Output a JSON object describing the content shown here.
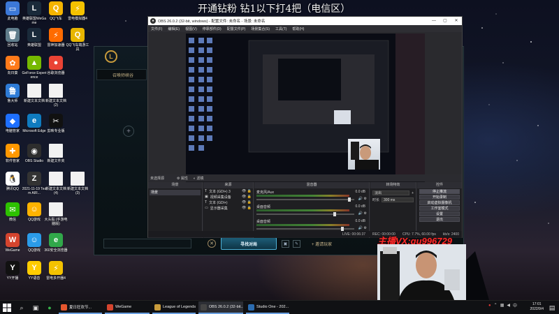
{
  "stream_title": "开通钻粉 钻1以下打4把（电信区）",
  "desktop_icons": [
    {
      "label": "此电脑",
      "glyph": "▭",
      "color": "#3c78d8"
    },
    {
      "label": "英雄联盟WeGame",
      "glyph": "L",
      "color": "#1a2a3a"
    },
    {
      "label": "QQ飞车",
      "glyph": "Q",
      "color": "#f5b400"
    },
    {
      "label": "雷电模拟器4",
      "glyph": "⚡",
      "color": "#f4c200"
    },
    {
      "label": "回收站",
      "glyph": "🗑",
      "color": "#607d8b"
    },
    {
      "label": "英雄联盟",
      "glyph": "L",
      "color": "#1a2a3a"
    },
    {
      "label": "雷神加速器",
      "glyph": "⚡",
      "color": "#ff6b00"
    },
    {
      "label": "QQ飞车端游工具",
      "glyph": "Q",
      "color": "#e8b600"
    },
    {
      "label": "向日葵",
      "glyph": "✿",
      "color": "#ff7a1a"
    },
    {
      "label": "GeForce Experience",
      "glyph": "▲",
      "color": "#76b900"
    },
    {
      "label": "谷歌浏览器",
      "glyph": "●",
      "color": "#ea4335"
    },
    {
      "label": "鲁大师",
      "glyph": "鲁",
      "color": "#2e7bd6"
    },
    {
      "label": "新建文本文档",
      "glyph": "",
      "color": "#f2f2f2"
    },
    {
      "label": "新建文本文档 (2)",
      "glyph": "",
      "color": "#f2f2f2"
    },
    {
      "label": "电脑管家",
      "glyph": "◆",
      "color": "#1e6fff"
    },
    {
      "label": "Microsoft Edge",
      "glyph": "e",
      "color": "#0f7bbf"
    },
    {
      "label": "剪映专业版",
      "glyph": "✂",
      "color": "#111111"
    },
    {
      "label": "软件管家",
      "glyph": "✚",
      "color": "#ff9800"
    },
    {
      "label": "OBS Studio",
      "glyph": "◉",
      "color": "#2d2d2d"
    },
    {
      "label": "新建文件夹",
      "glyph": "",
      "color": "#f2f2f2"
    },
    {
      "label": "腾讯QQ",
      "glyph": "🐧",
      "color": "#ffffff"
    },
    {
      "label": "2021-11-19 Team AIR...",
      "glyph": "Z",
      "color": "#333333"
    },
    {
      "label": "新建文本文档 (4)",
      "glyph": "",
      "color": "#f2f2f2"
    },
    {
      "label": "新建文本文档 (3)",
      "glyph": "",
      "color": "#f2f2f2"
    },
    {
      "label": "微信",
      "glyph": "✉",
      "color": "#2dc100"
    },
    {
      "label": "QQ游戏",
      "glyph": "☺",
      "color": "#ffb300"
    },
    {
      "label": "大头贴 (手游电脑版)",
      "glyph": "",
      "color": "#f2f2f2"
    },
    {
      "label": "WeGame",
      "glyph": "W",
      "color": "#d4442e"
    },
    {
      "label": "QQ游戏",
      "glyph": "☺",
      "color": "#2b9be8"
    },
    {
      "label": "360安全浏览器",
      "glyph": "e",
      "color": "#31a84a"
    },
    {
      "label": "YY开播",
      "glyph": "Y",
      "color": "#111111"
    },
    {
      "label": "YY语音",
      "glyph": "Y",
      "color": "#ffcc00"
    },
    {
      "label": "雷电多开器4",
      "glyph": "⚡",
      "color": "#f4c200"
    }
  ],
  "lol": {
    "logo": "L",
    "tab_label": "召唤师峡谷",
    "find_match": "寻找对局",
    "invite": "邀请玩家",
    "close": "✕"
  },
  "obs": {
    "title": "OBS 26.0.2 (32-bit, windows) - 配置文件: 未命名 - 场景: 未命名",
    "menu": [
      "文件(F)",
      "编辑(E)",
      "视图(V)",
      "停靠部件(D)",
      "配置文件(P)",
      "场景集合(S)",
      "工具(T)",
      "帮助(H)"
    ],
    "no_source": "未选择源",
    "properties": "属性",
    "filters": "滤镜",
    "docks": {
      "scenes": "场景",
      "sources": "来源",
      "mixer": "混音器",
      "transitions": "转场特效",
      "controls": "控件"
    },
    "scene_item": "场景",
    "sources_list": [
      {
        "label": "文本 (GDI+) 3",
        "icon": "T"
      },
      {
        "label": "视频采集设备",
        "icon": "▣"
      },
      {
        "label": "文本 (GDI+)",
        "icon": "T"
      },
      {
        "label": "显示器采集",
        "icon": "▭"
      }
    ],
    "mixer": [
      {
        "label": "麦克风/Aux",
        "value": "0.0 dB",
        "level": 0.95
      },
      {
        "label": "桌面音频",
        "value": "0.0 dB",
        "level": 0.8
      },
      {
        "label": "桌面音频",
        "value": "0.0 dB",
        "level": 0.88
      }
    ],
    "transition_type": "淡出",
    "duration_label": "时长",
    "duration_value": "300 ms",
    "controls": [
      "停止推流",
      "开始录制",
      "启动虚拟摄像机",
      "工作室模式",
      "设置",
      "退出"
    ],
    "status": {
      "live": "LIVE: 00:06:37",
      "rec": "REC: 00:00:00",
      "cpu": "CPU: 7.7%, 60.00 fps",
      "kbps": "kb/s: 2400"
    }
  },
  "watermark": "主播VX:qu996729",
  "taskbar": {
    "search_icon": "search-icon",
    "apps": [
      {
        "label": "夏日狂欢节...",
        "color": "#e4572e"
      },
      {
        "label": "WeGame",
        "color": "#d4442e"
      },
      {
        "label": "League of Legends",
        "color": "#c89b3c"
      },
      {
        "label": "OBS 26.0.2 (32-bit...",
        "color": "#444444"
      },
      {
        "label": "Studio One - 202...",
        "color": "#2b6cb0"
      }
    ],
    "time": "17:01",
    "date": "2022/9/4"
  }
}
